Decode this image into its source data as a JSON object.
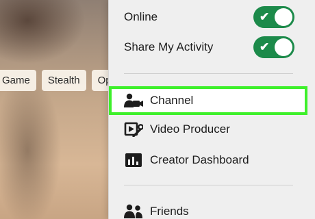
{
  "background": {
    "tags": [
      "Game",
      "Stealth",
      "Ope"
    ]
  },
  "menu": {
    "toggles": [
      {
        "label": "Online",
        "state": "on",
        "check": "✔"
      },
      {
        "label": "Share My Activity",
        "state": "on",
        "check": "✔"
      }
    ],
    "items": [
      {
        "label": "Channel",
        "icon": "channel-camera-icon",
        "highlighted": true
      },
      {
        "label": "Video Producer",
        "icon": "video-producer-icon"
      },
      {
        "label": "Creator Dashboard",
        "icon": "creator-dashboard-icon"
      },
      {
        "label": "Friends",
        "icon": "friends-icon"
      }
    ]
  },
  "colors": {
    "toggle_on": "#1c8a4a",
    "highlight_border": "#3ef02b",
    "menu_background": "#efefef"
  }
}
